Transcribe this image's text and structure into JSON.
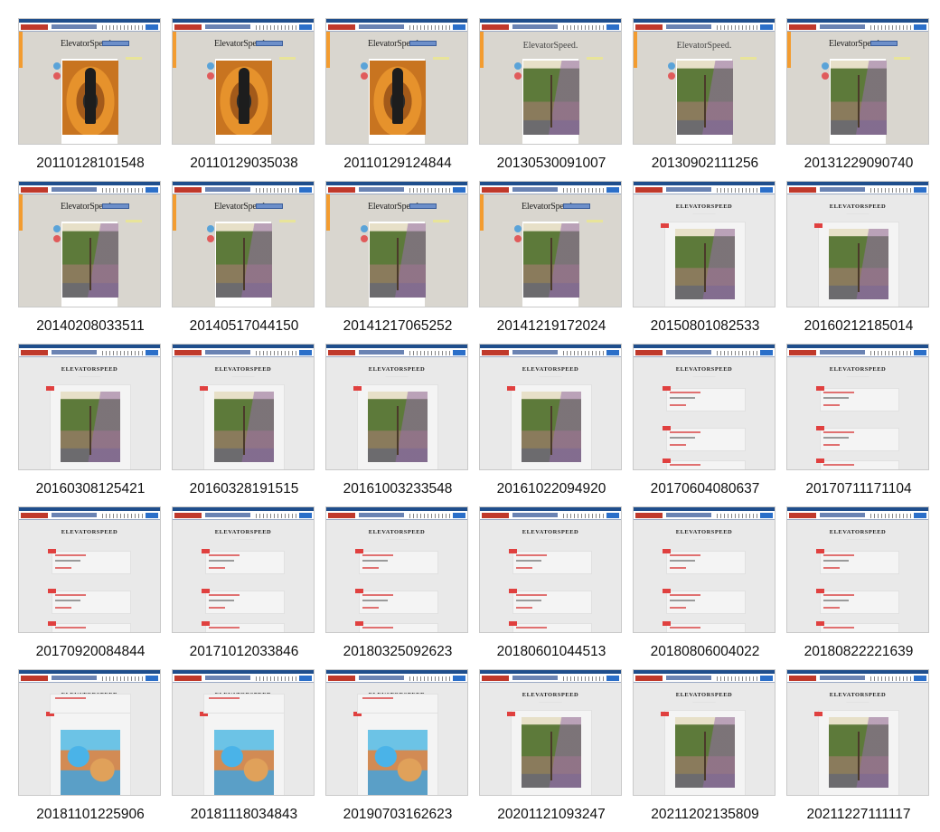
{
  "captures": [
    {
      "timestamp": "20110128101548",
      "style": "old-officer"
    },
    {
      "timestamp": "20110129035038",
      "style": "old-officer"
    },
    {
      "timestamp": "20110129124844",
      "style": "old-officer"
    },
    {
      "timestamp": "20130530091007",
      "style": "old-palm-banner"
    },
    {
      "timestamp": "20130902111256",
      "style": "old-palm-banner"
    },
    {
      "timestamp": "20131229090740",
      "style": "old-palm"
    },
    {
      "timestamp": "20140208033511",
      "style": "old-palm"
    },
    {
      "timestamp": "20140517044150",
      "style": "old-palm"
    },
    {
      "timestamp": "20141217065252",
      "style": "old-palm"
    },
    {
      "timestamp": "20141219172024",
      "style": "old-palm"
    },
    {
      "timestamp": "20150801082533",
      "style": "new-palm"
    },
    {
      "timestamp": "20160212185014",
      "style": "new-palm"
    },
    {
      "timestamp": "20160308125421",
      "style": "new-palm"
    },
    {
      "timestamp": "20160328191515",
      "style": "new-palm"
    },
    {
      "timestamp": "20161003233548",
      "style": "new-palm"
    },
    {
      "timestamp": "20161022094920",
      "style": "new-palm"
    },
    {
      "timestamp": "20170604080637",
      "style": "new-text"
    },
    {
      "timestamp": "20170711171104",
      "style": "new-text"
    },
    {
      "timestamp": "20170920084844",
      "style": "new-text"
    },
    {
      "timestamp": "20171012033846",
      "style": "new-text"
    },
    {
      "timestamp": "20180325092623",
      "style": "new-text"
    },
    {
      "timestamp": "20180601044513",
      "style": "new-text"
    },
    {
      "timestamp": "20180806004022",
      "style": "new-text"
    },
    {
      "timestamp": "20180822221639",
      "style": "new-text"
    },
    {
      "timestamp": "20181101225906",
      "style": "new-colorful"
    },
    {
      "timestamp": "20181118034843",
      "style": "new-colorful"
    },
    {
      "timestamp": "20190703162623",
      "style": "new-colorful"
    },
    {
      "timestamp": "20201121093247",
      "style": "new-palm"
    },
    {
      "timestamp": "20211202135809",
      "style": "new-palm"
    },
    {
      "timestamp": "20211227111117",
      "style": "new-palm"
    }
  ],
  "site": {
    "old_logo": "ElevatorSpeed.",
    "new_title": "ELEVATORSPEED"
  },
  "colors": {
    "toolbar": "#1f4e8c",
    "accent_red": "#e0403f",
    "old_bg": "#d9d6cf",
    "new_bg": "#e9e9e9"
  }
}
